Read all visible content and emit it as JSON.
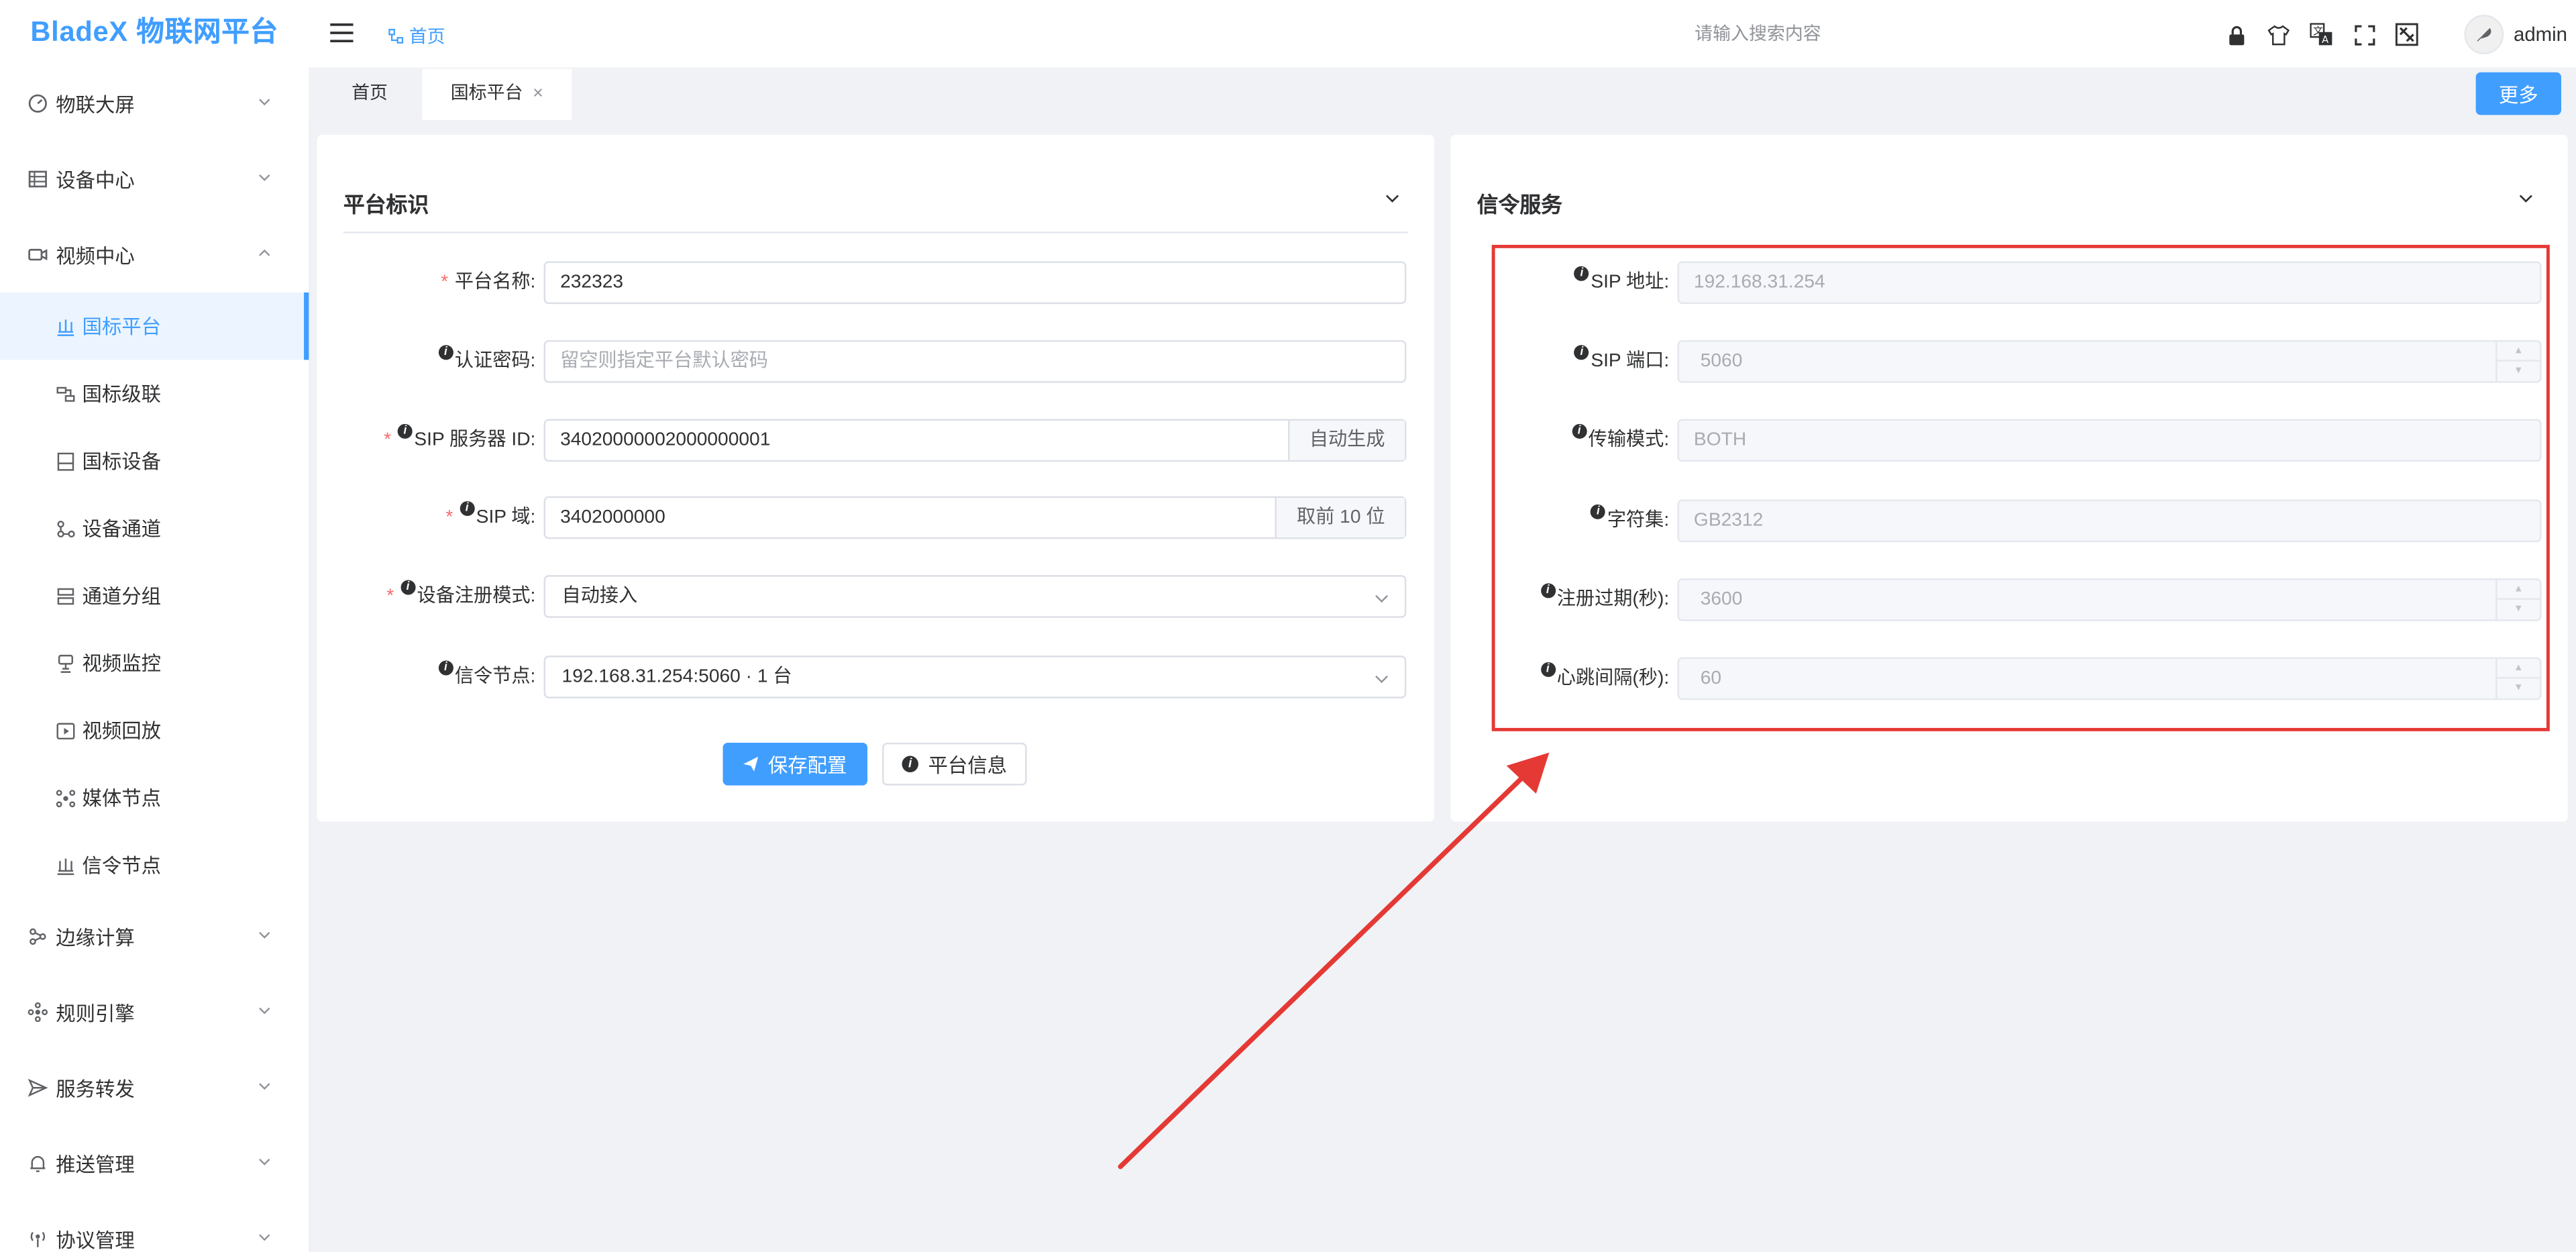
{
  "app": {
    "logo": "BladeX 物联网平台"
  },
  "header": {
    "breadcrumb": "首页",
    "search_placeholder": "请输入搜索内容",
    "icons": [
      "lock-icon",
      "theme-icon",
      "language-icon",
      "fullscreen-icon",
      "screen-tool-icon"
    ],
    "user": "admin"
  },
  "sidebar": {
    "menus_top": [
      {
        "label": "物联大屏",
        "icon": "dashboard-icon"
      },
      {
        "label": "设备中心",
        "icon": "device-icon"
      },
      {
        "label": "视频中心",
        "icon": "video-icon"
      }
    ],
    "sub_items": [
      {
        "label": "国标平台",
        "icon": "platform-icon",
        "active": true
      },
      {
        "label": "国标级联",
        "icon": "cascade-icon"
      },
      {
        "label": "国标设备",
        "icon": "gb-device-icon"
      },
      {
        "label": "设备通道",
        "icon": "channel-icon"
      },
      {
        "label": "通道分组",
        "icon": "group-icon"
      },
      {
        "label": "视频监控",
        "icon": "monitor-icon"
      },
      {
        "label": "视频回放",
        "icon": "playback-icon"
      },
      {
        "label": "媒体节点",
        "icon": "media-node-icon"
      },
      {
        "label": "信令节点",
        "icon": "signal-node-icon"
      }
    ],
    "menus_bottom": [
      {
        "label": "边缘计算",
        "icon": "edge-icon"
      },
      {
        "label": "规则引擎",
        "icon": "rule-icon"
      },
      {
        "label": "服务转发",
        "icon": "forward-icon"
      },
      {
        "label": "推送管理",
        "icon": "bell-icon"
      },
      {
        "label": "协议管理",
        "icon": "protocol-icon"
      }
    ]
  },
  "tabs": [
    {
      "label": "首页"
    },
    {
      "label": "国标平台",
      "close": "×"
    }
  ],
  "more_button": "更多",
  "platform_card": {
    "title": "平台标识",
    "fields": {
      "name": {
        "label": "平台名称:",
        "value": "232323"
      },
      "password": {
        "label": "认证密码:",
        "placeholder": "留空则指定平台默认密码"
      },
      "sip_id": {
        "label": "SIP 服务器 ID:",
        "value": "34020000002000000001",
        "append": "自动生成"
      },
      "sip_domain": {
        "label": "SIP 域:",
        "value": "3402000000",
        "append": "取前 10 位"
      },
      "register_mode": {
        "label": "设备注册模式:",
        "value": "自动接入"
      },
      "signal_node": {
        "label": "信令节点:",
        "value": "192.168.31.254:5060 · 1 台"
      }
    },
    "save_button": "保存配置",
    "info_button": "平台信息"
  },
  "signal_card": {
    "title": "信令服务",
    "fields": {
      "sip_address": {
        "label": "SIP 地址:",
        "value": "192.168.31.254"
      },
      "sip_port": {
        "label": "SIP 端口:",
        "value": "5060"
      },
      "transport": {
        "label": "传输模式:",
        "value": "BOTH"
      },
      "charset": {
        "label": "字符集:",
        "value": "GB2312"
      },
      "register_expire": {
        "label": "注册过期(秒):",
        "value": "3600"
      },
      "heartbeat": {
        "label": "心跳间隔(秒):",
        "value": "60"
      }
    }
  },
  "annotation": {
    "color": "#e53935"
  },
  "colors": {
    "primary": "#409eff",
    "danger": "#f56c6c"
  }
}
